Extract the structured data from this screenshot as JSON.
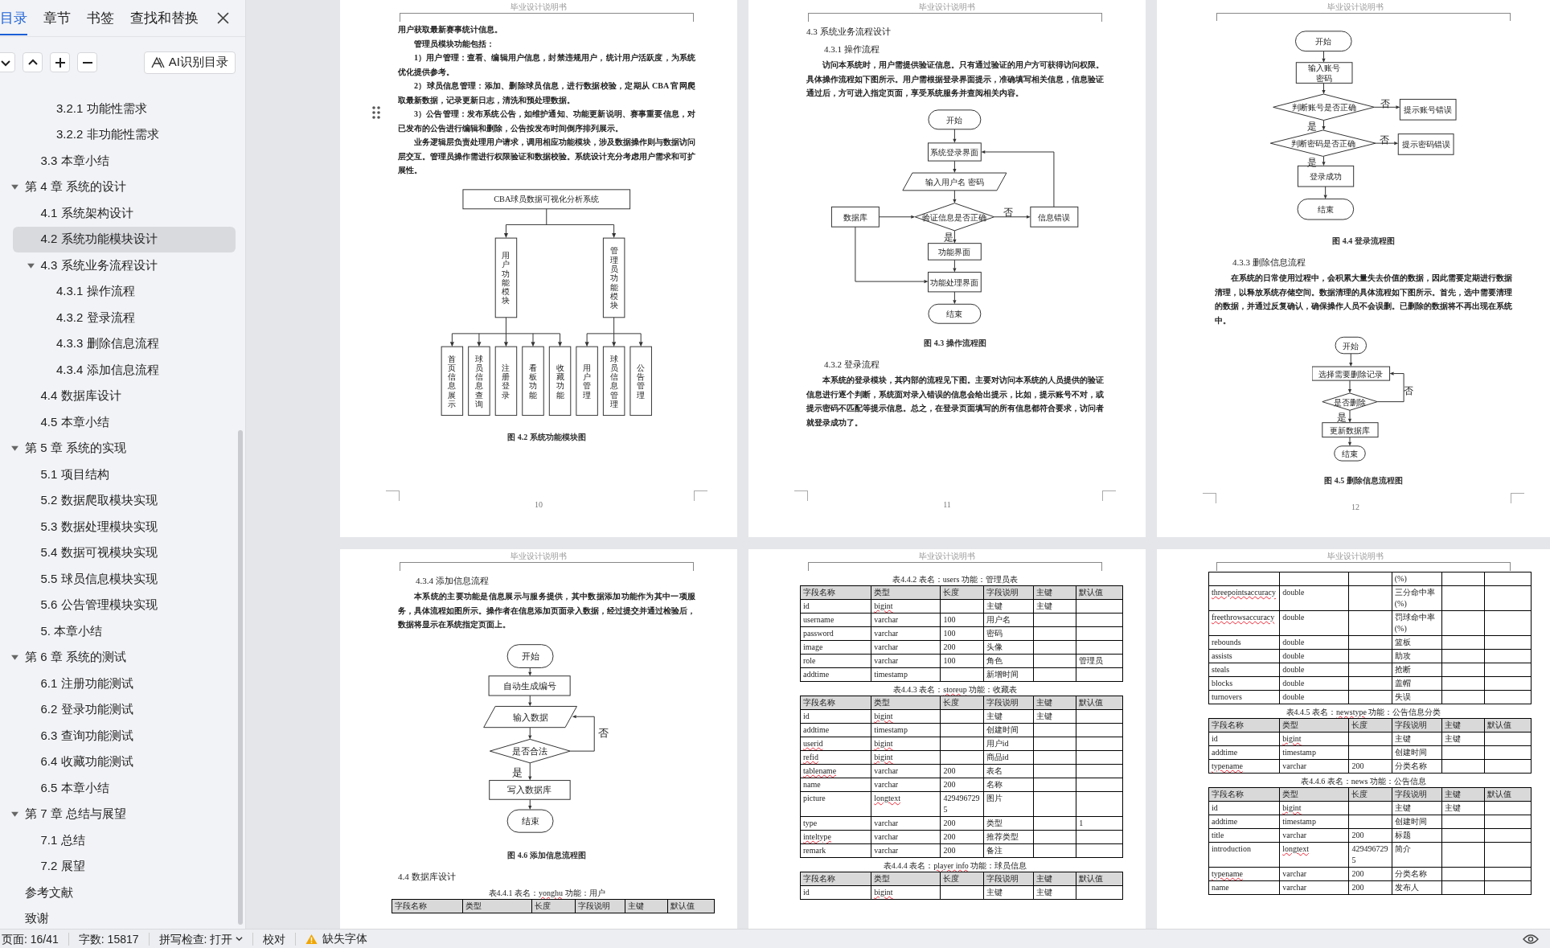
{
  "sidebar": {
    "tabs": [
      {
        "label": "目录",
        "selected": true
      },
      {
        "label": "章节",
        "selected": false
      },
      {
        "label": "书签",
        "selected": false
      },
      {
        "label": "查找和替换",
        "selected": false
      }
    ],
    "ai_button": "AI识别目录",
    "outline": [
      {
        "children": [
          {
            "children": [
              {
                "label": "3.2.1 功能性需求",
                "selected": false
              },
              {
                "label": "3.2.2 非功能性需求",
                "selected": false
              }
            ]
          },
          {
            "label": "3.3 本章小结",
            "selected": false
          }
        ]
      },
      {
        "label": "第 4 章 系统的设计",
        "expanded": true,
        "selected": false,
        "children": [
          {
            "label": "4.1 系统架构设计",
            "selected": false
          },
          {
            "label": "4.2 系统功能模块设计",
            "selected": true
          },
          {
            "label": "4.3 系统业务流程设计",
            "expanded": true,
            "selected": false,
            "children": [
              {
                "label": "4.3.1 操作流程",
                "selected": false
              },
              {
                "label": "4.3.2 登录流程",
                "selected": false
              },
              {
                "label": "4.3.3 删除信息流程",
                "selected": false
              },
              {
                "label": "4.3.4 添加信息流程",
                "selected": false
              }
            ]
          },
          {
            "label": "4.4 数据库设计",
            "selected": false
          },
          {
            "label": "4.5 本章小结",
            "selected": false
          }
        ]
      },
      {
        "label": "第 5 章 系统的实现",
        "expanded": true,
        "selected": false,
        "children": [
          {
            "label": "5.1 项目结构",
            "selected": false
          },
          {
            "label": "5.2 数据爬取模块实现",
            "selected": false
          },
          {
            "label": "5.3 数据处理模块实现",
            "selected": false
          },
          {
            "label": "5.4 数据可视模块实现",
            "selected": false
          },
          {
            "label": "5.5 球员信息模块实现",
            "selected": false
          },
          {
            "label": "5.6 公告管理模块实现",
            "selected": false
          },
          {
            "label": "5. 本章小结",
            "selected": false
          }
        ]
      },
      {
        "label": "第 6 章 系统的测试",
        "expanded": true,
        "selected": false,
        "children": [
          {
            "label": "6.1 注册功能测试",
            "selected": false
          },
          {
            "label": "6.2 登录功能测试",
            "selected": false
          },
          {
            "label": "6.3 查询功能测试",
            "selected": false
          },
          {
            "label": "6.4 收藏功能测试",
            "selected": false
          },
          {
            "label": "6.5 本章小结",
            "selected": false
          }
        ]
      },
      {
        "label": "第 7 章 总结与展望",
        "expanded": true,
        "selected": false,
        "children": [
          {
            "label": "7.1 总结",
            "selected": false
          },
          {
            "label": "7.2 展望",
            "selected": false
          }
        ]
      },
      {
        "label": "参考文献",
        "selected": false
      },
      {
        "label": "致谢",
        "selected": false
      }
    ]
  },
  "pages": [
    {
      "header": "毕业设计说明书",
      "number": "10",
      "blocks": [
        {
          "kind": "continuation",
          "text": "用户获取最新赛事统计信息。"
        },
        {
          "kind": "paragraph",
          "text": "管理员模块功能包括："
        },
        {
          "kind": "paragraph",
          "text": "1）用户管理：查看、编辑用户信息，封禁违规用户，统计用户活跃度，为系统优化提供参考。"
        },
        {
          "kind": "paragraph",
          "text": "2）球员信息管理：添加、删除球员信息，进行数据校验，定期从 CBA 官网爬取最新数据，记录更新日志，清洗和预处理数据。"
        },
        {
          "kind": "paragraph",
          "text": "3）公告管理：发布系统公告，如维护通知、功能更新说明、赛事重要信息，对已发布的公告进行编辑和删除，公告按发布时间倒序排列展示。"
        },
        {
          "kind": "paragraph",
          "text": "业务逻辑层负责处理用户请求，调用相应功能模块，涉及数据操作则与数据访问层交互。管理员操作需进行权限验证和数据校验。系统设计充分考虑用户需求和可扩展性。"
        },
        {
          "kind": "orgchart",
          "root": "CBA球员数据可视化分析系统",
          "branches": [
            {
              "label": "用户功能模块",
              "children": [
                "首页信息展示",
                "球员信息查询",
                "注册登录",
                "看板功能",
                "收藏功能"
              ]
            },
            {
              "label": "管理员功能模块",
              "children": [
                "用户管理",
                "球员信息管理",
                "公告管理"
              ]
            }
          ]
        },
        {
          "kind": "caption",
          "text": "图 4.2  系统功能模块图"
        }
      ]
    },
    {
      "header": "毕业设计说明书",
      "number": "11",
      "blocks": [
        {
          "kind": "heading",
          "text": "4.3  系统业务流程设计"
        },
        {
          "kind": "subheading",
          "text": "4.3.1  操作流程"
        },
        {
          "kind": "paragraph",
          "text": "访问本系统时，用户需提供验证信息。只有通过验证的用户方可获得访问权限。具体操作流程如下图所示。用户需根据登录界面提示，准确填写相关信息，信息验证通过后，方可进入指定页面，享受系统服务并查阅相关内容。"
        },
        {
          "kind": "operationflow",
          "nodes": [
            "开始",
            "系统登录界面",
            "输入用户名 密码",
            "数据库",
            "验证信息是否正确",
            "信息错误",
            "功能界面",
            "功能处理界面",
            "结束"
          ],
          "branch_labels": [
            "否",
            "是"
          ]
        },
        {
          "kind": "caption",
          "text": "图 4.3  操作流程图"
        },
        {
          "kind": "subheading",
          "text": "4.3.2  登录流程"
        },
        {
          "kind": "paragraph",
          "text": "本系统的登录模块，其内部的流程见下图。主要对访问本系统的人员提供的验证信息进行逐个判断，系统面对录入错误的信息会给出提示，比如，提示账号不对，或提示密码不匹配等提示信息。总之，在登录页面填写的所有信息都符合要求，访问者就登录成功了。"
        }
      ]
    },
    {
      "header": "毕业设计说明书",
      "number": "12",
      "blocks": [
        {
          "kind": "loginflow",
          "nodes": [
            "开始",
            "输入账号密码",
            "判断账号是否正确",
            "提示账号错误",
            "判断密码是否正确",
            "提示密码错误",
            "登录成功",
            "结束"
          ],
          "branch_labels": [
            "否",
            "是",
            "否",
            "是"
          ]
        },
        {
          "kind": "caption",
          "text": "图 4.4  登录流程图"
        },
        {
          "kind": "subheading",
          "text": "4.3.3  删除信息流程"
        },
        {
          "kind": "paragraph",
          "text": "在系统的日常使用过程中，会积累大量失去价值的数据，因此需要定期进行数据清理，以释放系统存储空间。数据清理的具体流程如下图所示。首先，选中需要清理的数据，并通过反复确认，确保操作人员不会误删。已删除的数据将不再出现在系统中。"
        },
        {
          "kind": "deleteflow",
          "nodes": [
            "开始",
            "选择需要删除记录",
            "是否删除",
            "更新数据库",
            "结束"
          ],
          "branch_labels": [
            "否",
            "是"
          ]
        },
        {
          "kind": "caption",
          "text": "图 4.5  删除信息流程图"
        }
      ]
    },
    {
      "header": "毕业设计说明书",
      "blocks": [
        {
          "kind": "subheading",
          "text": "4.3.4  添加信息流程"
        },
        {
          "kind": "paragraph",
          "text": "本系统的主要功能是信息展示与服务提供，其中数据添加功能作为其中一项服务，具体流程如图所示。操作者在信息添加页面录入数据，经过提交并通过检验后，数据将显示在系统指定页面上。"
        },
        {
          "kind": "addflow",
          "nodes": [
            "开始",
            "自动生成编号",
            "输入数据",
            "是否合法",
            "写入数据库",
            "结束"
          ],
          "branch_labels": [
            "否",
            "是"
          ]
        },
        {
          "kind": "caption",
          "text": "图 4.6  添加信息流程图"
        },
        {
          "kind": "heading",
          "text": "4.4  数据库设计"
        },
        {
          "kind": "table",
          "caption": [
            {
              "text": "表4.4.1 表名："
            },
            {
              "text": "yonghu",
              "misspelled": true
            },
            {
              "text": " 功能：用户"
            }
          ],
          "columns": [
            "字段名称",
            "类型",
            "长度",
            "字段说明",
            "主键",
            "默认值"
          ]
        }
      ]
    },
    {
      "header": "毕业设计说明书",
      "blocks": [
        {
          "kind": "table",
          "caption": [
            {
              "text": "表4.4.2 表名：users 功能：管理员表"
            }
          ],
          "columns": [
            "字段名称",
            "类型",
            "长度",
            "字段说明",
            "主键",
            "默认值"
          ],
          "rows": [
            [
              "id",
              {
                "text": "bigint",
                "misspelled": true
              },
              null,
              "主键",
              "主键",
              null
            ],
            [
              "username",
              "varchar",
              "100",
              "用户名",
              null,
              null
            ],
            [
              "password",
              "varchar",
              "100",
              "密码",
              null,
              null
            ],
            [
              "image",
              "varchar",
              "200",
              "头像",
              null,
              null
            ],
            [
              "role",
              "varchar",
              "100",
              "角色",
              null,
              "管理员"
            ],
            [
              "addtime",
              "timestamp",
              null,
              "新增时间",
              null,
              null
            ]
          ]
        },
        {
          "kind": "table",
          "caption": [
            {
              "text": "表4.4.3 表名："
            },
            {
              "text": "storeup",
              "misspelled": true
            },
            {
              "text": " 功能：收藏表"
            }
          ],
          "columns": [
            "字段名称",
            "类型",
            "长度",
            "字段说明",
            "主键",
            "默认值"
          ],
          "rows": [
            [
              "id",
              {
                "text": "bigint",
                "misspelled": true
              },
              null,
              "主键",
              "主键",
              null
            ],
            [
              "addtime",
              "timestamp",
              null,
              "创建时间",
              null,
              null
            ],
            [
              {
                "text": "userid",
                "misspelled": true
              },
              {
                "text": "bigint",
                "misspelled": true
              },
              null,
              "用户id",
              null,
              null
            ],
            [
              {
                "text": "refid",
                "misspelled": true
              },
              {
                "text": "bigint",
                "misspelled": true
              },
              null,
              "商品id",
              null,
              null
            ],
            [
              {
                "text": "tablename",
                "misspelled": true
              },
              "varchar",
              "200",
              "表名",
              null,
              null
            ],
            [
              "name",
              "varchar",
              "200",
              "名称",
              null,
              null
            ],
            [
              "picture",
              {
                "text": "longtext",
                "misspelled": true
              },
              "4294967295",
              "图片",
              null,
              null
            ],
            [
              "type",
              "varchar",
              "200",
              "类型",
              null,
              "1"
            ],
            [
              {
                "text": "inteltype",
                "misspelled": true
              },
              "varchar",
              "200",
              "推荐类型",
              null,
              null
            ],
            [
              "remark",
              "varchar",
              "200",
              "备注",
              null,
              null
            ]
          ]
        },
        {
          "kind": "table",
          "caption": [
            {
              "text": "表4.4.4 表名："
            },
            {
              "text": "player info",
              "misspelled": true
            },
            {
              "text": " 功能：球员信息"
            }
          ],
          "columns": [
            "字段名称",
            "类型",
            "长度",
            "字段说明",
            "主键",
            "默认值"
          ],
          "rows": [
            [
              "id",
              {
                "text": "bigint",
                "misspelled": true
              },
              null,
              "主键",
              "主键",
              null
            ]
          ]
        }
      ]
    },
    {
      "header": "毕业设计说明书",
      "blocks": [
        {
          "kind": "table",
          "rows": [
            [
              null,
              null,
              null,
              "(%)",
              null,
              null
            ],
            [
              {
                "text": "threepointsaccuracy",
                "misspelled": true
              },
              "double",
              null,
              "三分命中率(%)",
              null,
              null
            ],
            [
              {
                "text": "freethrowsaccuracy",
                "misspelled": true
              },
              "double",
              null,
              "罚球命中率(%)",
              null,
              null
            ],
            [
              "rebounds",
              "double",
              null,
              "篮板",
              null,
              null
            ],
            [
              "assists",
              "double",
              null,
              "助攻",
              null,
              null
            ],
            [
              "steals",
              "double",
              null,
              "抢断",
              null,
              null
            ],
            [
              "blocks",
              "double",
              null,
              "盖帽",
              null,
              null
            ],
            [
              "turnovers",
              "double",
              null,
              "失误",
              null,
              null
            ]
          ]
        },
        {
          "kind": "table",
          "caption": [
            {
              "text": "表4.4.5 表名："
            },
            {
              "text": "newstype",
              "misspelled": true
            },
            {
              "text": " 功能：公告信息分类"
            }
          ],
          "columns": [
            "字段名称",
            "类型",
            "长度",
            "字段说明",
            "主键",
            "默认值"
          ],
          "rows": [
            [
              "id",
              {
                "text": "bigint",
                "misspelled": true
              },
              null,
              "主键",
              "主键",
              null
            ],
            [
              "addtime",
              "timestamp",
              null,
              "创建时间",
              null,
              null
            ],
            [
              {
                "text": "typename",
                "misspelled": true
              },
              "varchar",
              "200",
              "分类名称",
              null,
              null
            ]
          ]
        },
        {
          "kind": "table",
          "caption": [
            {
              "text": "表4.4.6 表名：news 功能：公告信息"
            }
          ],
          "columns": [
            "字段名称",
            "类型",
            "长度",
            "字段说明",
            "主键",
            "默认值"
          ],
          "rows": [
            [
              "id",
              {
                "text": "bigint",
                "misspelled": true
              },
              null,
              "主键",
              "主键",
              null
            ],
            [
              "addtime",
              "timestamp",
              null,
              "创建时间",
              null,
              null
            ],
            [
              "title",
              "varchar",
              "200",
              "标题",
              null,
              null
            ],
            [
              "introduction",
              {
                "text": "longtext",
                "misspelled": true
              },
              "4294967295",
              "简介",
              null,
              null
            ],
            [
              {
                "text": "typename",
                "misspelled": true
              },
              "varchar",
              "200",
              "分类名称",
              null,
              null
            ],
            [
              "name",
              "varchar",
              "200",
              "发布人",
              null,
              null
            ]
          ]
        }
      ]
    }
  ],
  "status_bar": {
    "page": "页面: 16/41",
    "words": "字数: 15817",
    "spellcheck": "拼写检查: 打开",
    "proofread": "校对",
    "missing_fonts": "缺失字体"
  }
}
